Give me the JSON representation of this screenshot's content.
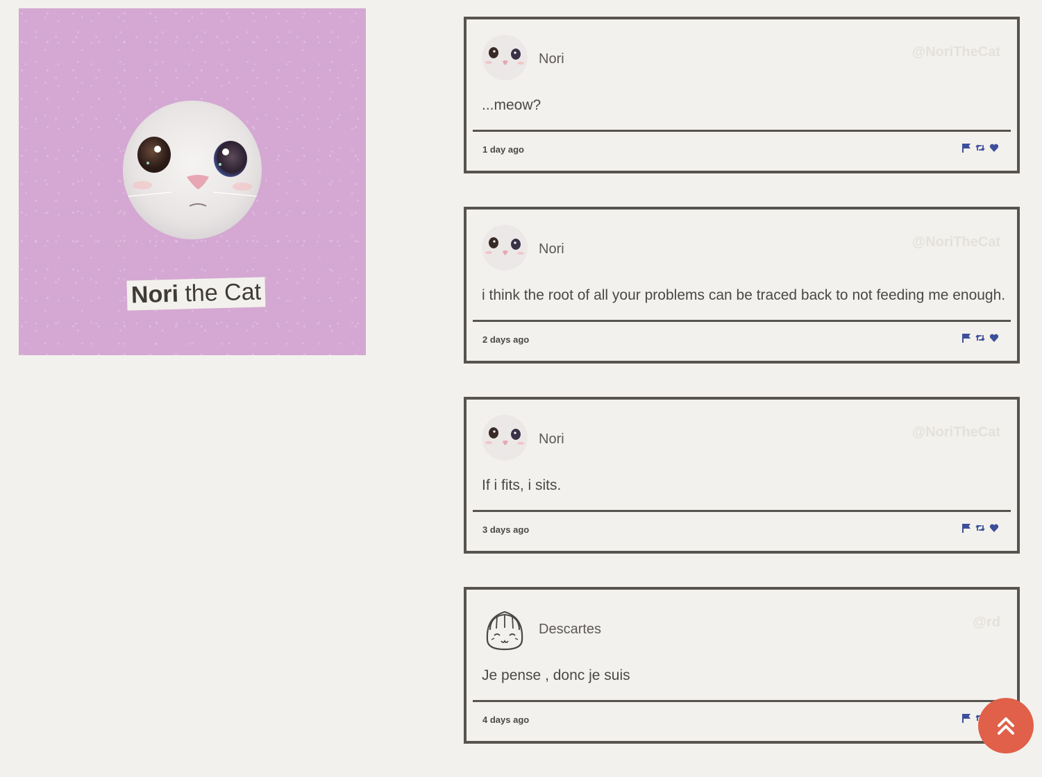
{
  "profile": {
    "name_first": "Nori",
    "name_rest": "the Cat",
    "background_color": "#d4a8d2",
    "photo": "cat-face-photo"
  },
  "accent_color": "#3d4f9a",
  "scroll_button_color": "#e0604a",
  "posts": [
    {
      "display_name": "Nori",
      "handle": "@NoriTheCat",
      "text": "...meow?",
      "time": "1 day ago",
      "avatar": "cat-avatar"
    },
    {
      "display_name": "Nori",
      "handle": "@NoriTheCat",
      "text": "i think the root of all your problems can be traced back to not feeding me enough.",
      "time": "2 days ago",
      "avatar": "cat-avatar"
    },
    {
      "display_name": "Nori",
      "handle": "@NoriTheCat",
      "text": "If i fits, i sits.",
      "time": "3 days ago",
      "avatar": "cat-avatar"
    },
    {
      "display_name": "Descartes",
      "handle": "@rd",
      "text": "Je pense , donc je suis",
      "time": "4 days ago",
      "avatar": "line-art-face-avatar"
    }
  ],
  "actions": [
    "flag-icon",
    "retweet-icon",
    "heart-icon"
  ],
  "scroll_top": "double-chevron-up-icon"
}
